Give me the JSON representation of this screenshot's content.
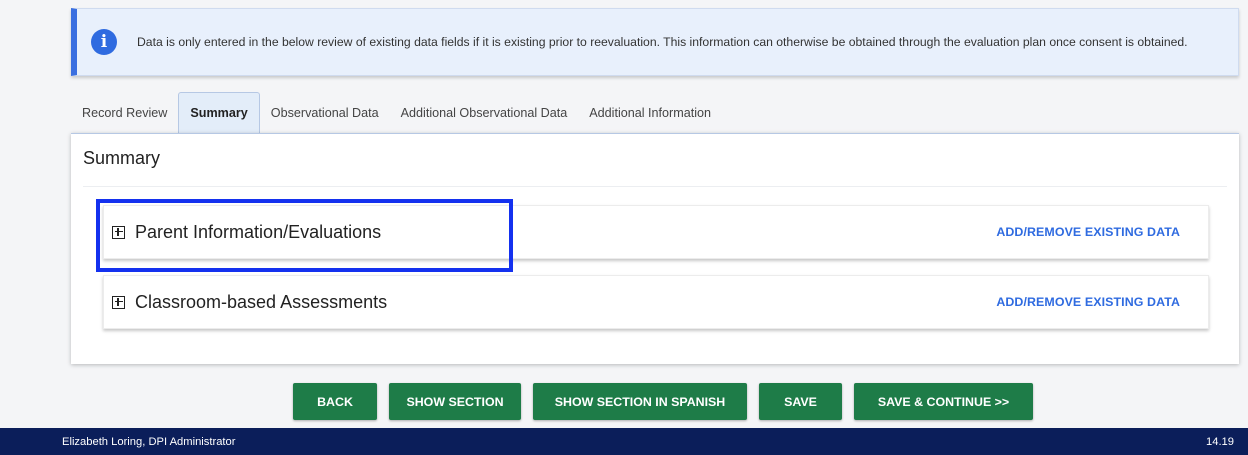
{
  "banner": {
    "icon": "info-icon",
    "text": "Data is only entered in the below review of existing data fields if it is existing prior to reevaluation. This information can otherwise be obtained through the evaluation plan once consent is obtained."
  },
  "tabs": [
    {
      "label": "Record Review",
      "active": false
    },
    {
      "label": "Summary",
      "active": true
    },
    {
      "label": "Observational Data",
      "active": false
    },
    {
      "label": "Additional Observational Data",
      "active": false
    },
    {
      "label": "Additional Information",
      "active": false
    }
  ],
  "summary": {
    "title": "Summary",
    "sections": [
      {
        "title": "Parent Information/Evaluations",
        "link": "ADD/REMOVE EXISTING DATA",
        "icon": "expand-plus-icon"
      },
      {
        "title": "Classroom-based Assessments",
        "link": "ADD/REMOVE EXISTING DATA",
        "icon": "expand-plus-icon"
      }
    ]
  },
  "buttons": {
    "back": "BACK",
    "show_section": "SHOW SECTION",
    "show_section_spanish": "SHOW SECTION IN SPANISH",
    "save": "SAVE",
    "save_continue": "SAVE & CONTINUE >>"
  },
  "footer": {
    "user": "Elizabeth Loring, DPI Administrator",
    "version": "14.19"
  },
  "colors": {
    "accent_blue": "#2f6be0",
    "button_green": "#1e7c48",
    "footer_navy": "#0b1e5a",
    "highlight_blue": "#1431ef"
  }
}
